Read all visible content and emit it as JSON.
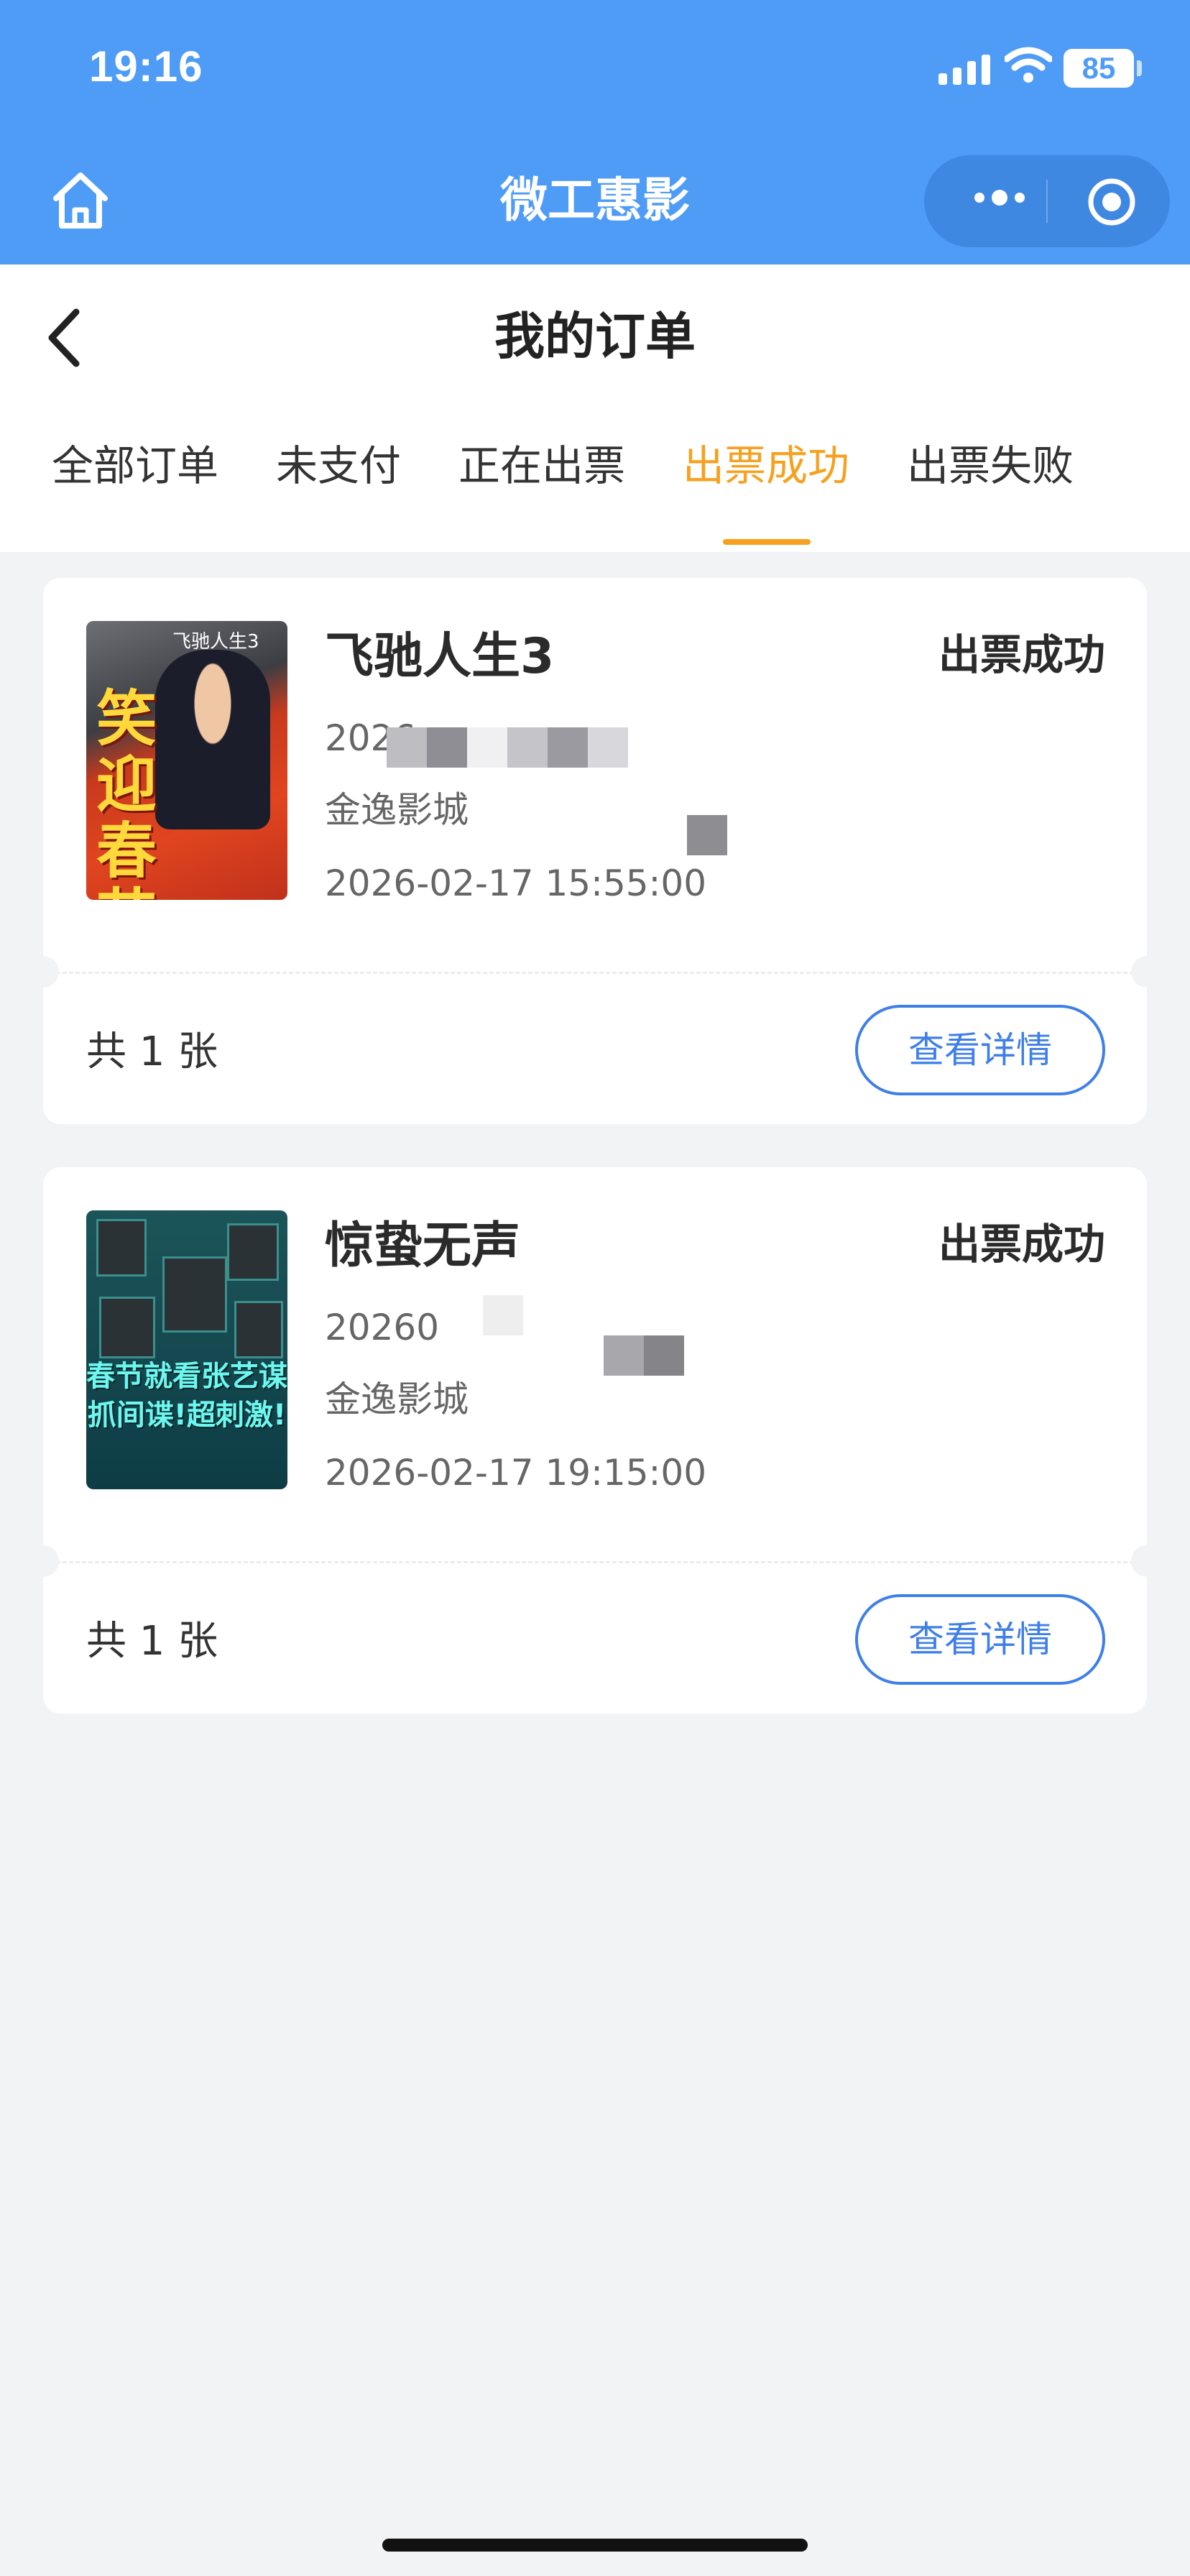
{
  "status_bar": {
    "time": "19:16",
    "battery": "85"
  },
  "mini_app": {
    "title": "微工惠影"
  },
  "header": {
    "title": "我的订单"
  },
  "tabs": [
    {
      "label": "全部订单",
      "active": false
    },
    {
      "label": "未支付",
      "active": false
    },
    {
      "label": "正在出票",
      "active": false
    },
    {
      "label": "出票成功",
      "active": true
    },
    {
      "label": "出票失败",
      "active": false
    }
  ],
  "orders": [
    {
      "title": "飞驰人生3",
      "status": "出票成功",
      "order_no": "2026",
      "cinema": "金逸影城",
      "showtime": "2026-02-17 15:55:00",
      "count": "共 1 张",
      "detail_label": "查看详情",
      "poster_text": "笑迎春节",
      "poster_tag": "飞驰人生3"
    },
    {
      "title": "惊蛰无声",
      "status": "出票成功",
      "order_no": "20260",
      "cinema": "金逸影城",
      "showtime": "2026-02-17 19:15:00",
      "count": "共 1 张",
      "detail_label": "查看详情",
      "poster_text_1": "春节就看张艺谋",
      "poster_text_2": "抓间谍!超刺激!"
    }
  ],
  "colors": {
    "primary": "#4f9cf7",
    "accent": "#f6a11f",
    "link": "#3f7fe8",
    "page_bg": "#f2f3f5"
  }
}
